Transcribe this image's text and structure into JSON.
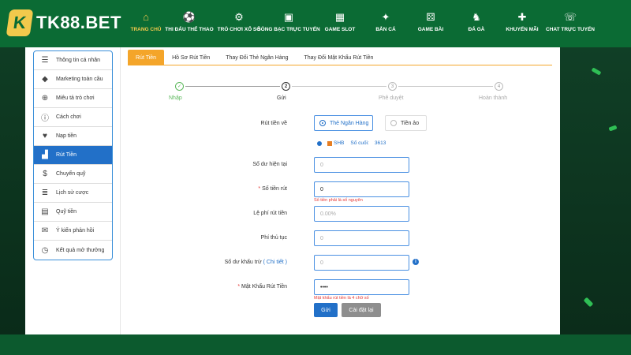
{
  "header": {
    "logo_text": "TK88.BET",
    "nav": [
      {
        "label": "TRANG CHỦ",
        "icon": "home-icon",
        "glyph": "⌂",
        "active": true,
        "width": 40
      },
      {
        "label": "THI ĐẤU THỂ THAO",
        "icon": "soccer-ball-icon",
        "glyph": "⚽",
        "width": 70
      },
      {
        "label": "TRÒ CHƠI XỔ SỐ",
        "icon": "lottery-icon",
        "glyph": "⚙",
        "width": 56
      },
      {
        "label": "SÒNG BẠC TRỰC TUYẾN",
        "icon": "casino-chip-icon",
        "glyph": "▣",
        "width": 70
      },
      {
        "label": "GAME SLOT",
        "icon": "slot-machine-icon",
        "glyph": "▦",
        "width": 60
      },
      {
        "label": "BẮN CÁ",
        "icon": "fish-icon",
        "glyph": "✦",
        "width": 56
      },
      {
        "label": "GAME BÀI",
        "icon": "dice-icon",
        "glyph": "⚄",
        "width": 58
      },
      {
        "label": "ĐÁ GÀ",
        "icon": "rooster-icon",
        "glyph": "♞",
        "width": 58
      },
      {
        "label": "KHUYẾN MÃI",
        "icon": "gift-icon",
        "glyph": "✚",
        "width": 58
      },
      {
        "label": "CHAT TRỰC TUYẾN",
        "icon": "chat-support-icon",
        "glyph": "☏",
        "width": 64
      }
    ]
  },
  "sidebar": {
    "items": [
      {
        "label": "Thông tin cá nhân",
        "icon": "profile-card-icon",
        "glyph": "☰"
      },
      {
        "label": "Marketing toàn cầu",
        "icon": "diamond-icon",
        "glyph": "◆"
      },
      {
        "label": "Miêu tả trò chơi",
        "icon": "gamepad-icon",
        "glyph": "⊕"
      },
      {
        "label": "Cách chơi",
        "icon": "info-circle-icon",
        "glyph": "ⓘ"
      },
      {
        "label": "Nạp tiền",
        "icon": "piggy-bank-icon",
        "glyph": "♥"
      },
      {
        "label": "Rút Tiền",
        "icon": "withdraw-icon",
        "glyph": "▟",
        "active": true
      },
      {
        "label": "Chuyển quỹ",
        "icon": "dollar-circle-icon",
        "glyph": "$"
      },
      {
        "label": "Lịch sử cược",
        "icon": "history-list-icon",
        "glyph": "≣"
      },
      {
        "label": "Quỹ tiền",
        "icon": "money-fund-icon",
        "glyph": "▤"
      },
      {
        "label": "Ý kiến phản hồi",
        "icon": "feedback-icon",
        "glyph": "✉"
      },
      {
        "label": "Kết quả mở thưởng",
        "icon": "clock-history-icon",
        "glyph": "◷"
      }
    ]
  },
  "tabs": [
    {
      "label": "Rút Tiền",
      "active": true
    },
    {
      "label": "Hồ Sơ Rút Tiền"
    },
    {
      "label": "Thay Đổi Thẻ Ngân Hàng"
    },
    {
      "label": "Thay Đổi Mật Khẩu Rút Tiền"
    }
  ],
  "steps": [
    {
      "num": "✓",
      "label": "Nhập",
      "state": "done"
    },
    {
      "num": "2",
      "label": "Gửi",
      "state": "current"
    },
    {
      "num": "3",
      "label": "Phê duyệt",
      "state": "pending"
    },
    {
      "num": "4",
      "label": "Hoàn thành",
      "state": "pending"
    }
  ],
  "form": {
    "withdraw_to_label": "Rút tiền về",
    "option_bank": "Thẻ Ngân Hàng",
    "option_virtual": "Tiền ảo",
    "bank_name": "SHB",
    "last_digits_label": "Số cuối:",
    "last_digits": "3613",
    "balance_label": "Số dư hiện tại",
    "balance_value": "0",
    "amount_label": "Số tiền rút",
    "amount_value": "0",
    "amount_error": "Số tiền phải là số nguyên",
    "fee_label": "Lệ phí rút tiền",
    "fee_value": "0.00%",
    "procedure_fee_label": "Phí thủ tục",
    "procedure_fee_value": "0",
    "deduct_label": "Số dư khấu trừ",
    "deduct_detail_link": "( Chi tiết )",
    "deduct_value": "0",
    "password_label": "Mật Khẩu Rút Tiền",
    "password_value": "••••",
    "password_error": "Mật khẩu rút tiền là 4 chữ số",
    "submit_label": "Gửi",
    "reset_label": "Cài đặt lại"
  }
}
